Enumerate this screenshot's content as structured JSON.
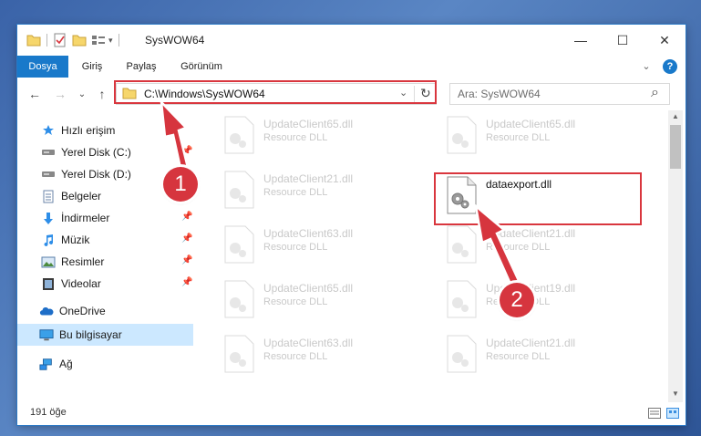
{
  "window": {
    "title": "SysWOW64",
    "controls": {
      "minimize": "—",
      "maximize": "☐",
      "close": "✕"
    }
  },
  "ribbon": {
    "tabs": [
      {
        "label": "Dosya",
        "active": true
      },
      {
        "label": "Giriş"
      },
      {
        "label": "Paylaş"
      },
      {
        "label": "Görünüm"
      }
    ],
    "help": "?",
    "expand": "⌄"
  },
  "nav": {
    "back": "←",
    "forward": "→",
    "recent": "⌄",
    "up": "↑",
    "address": "C:\\Windows\\SysWOW64",
    "address_dropdown": "⌄",
    "refresh": "↻",
    "search_placeholder": "Ara: SysWOW64",
    "search_icon": "⌕"
  },
  "sidebar": {
    "items": [
      {
        "label": "Hızlı erişim",
        "icon": "star-icon",
        "pinned": false
      },
      {
        "label": "Yerel Disk (C:)",
        "icon": "drive-icon",
        "pinned": true
      },
      {
        "label": "Yerel Disk (D:)",
        "icon": "drive-icon",
        "pinned": true
      },
      {
        "label": "Belgeler",
        "icon": "document-icon",
        "pinned": true
      },
      {
        "label": "İndirmeler",
        "icon": "download-icon",
        "pinned": true
      },
      {
        "label": "Müzik",
        "icon": "music-icon",
        "pinned": true
      },
      {
        "label": "Resimler",
        "icon": "picture-icon",
        "pinned": true
      },
      {
        "label": "Videolar",
        "icon": "video-icon",
        "pinned": true
      },
      {
        "label": "OneDrive",
        "icon": "cloud-icon",
        "pinned": false
      },
      {
        "label": "Bu bilgisayar",
        "icon": "computer-icon",
        "pinned": false,
        "selected": true
      },
      {
        "label": "Ağ",
        "icon": "network-icon",
        "pinned": false
      }
    ]
  },
  "files": {
    "left": [
      {
        "name": "UpdateClient65.dll",
        "type": "Resource DLL"
      },
      {
        "name": "UpdateClient21.dll",
        "type": "Resource DLL"
      },
      {
        "name": "UpdateClient63.dll",
        "type": "Resource DLL"
      },
      {
        "name": "UpdateClient65.dll",
        "type": "Resource DLL"
      },
      {
        "name": "UpdateClient63.dll",
        "type": "Resource DLL"
      }
    ],
    "right": [
      {
        "name": "UpdateClient65.dll",
        "type": "Resource DLL"
      },
      {
        "name": "dataexport.dll",
        "type": "",
        "highlighted": true
      },
      {
        "name": "UpdateClient21.dll",
        "type": "Resource DLL"
      },
      {
        "name": "UpdateClient19.dll",
        "type": "Resource DLL"
      },
      {
        "name": "UpdateClient21.dll",
        "type": "Resource DLL"
      }
    ]
  },
  "status": {
    "count": "191 öğe"
  },
  "annotations": {
    "badge1": "1",
    "badge2": "2"
  },
  "colors": {
    "accent": "#1979ca",
    "highlight": "#d9363e",
    "selected": "#cce8ff"
  }
}
